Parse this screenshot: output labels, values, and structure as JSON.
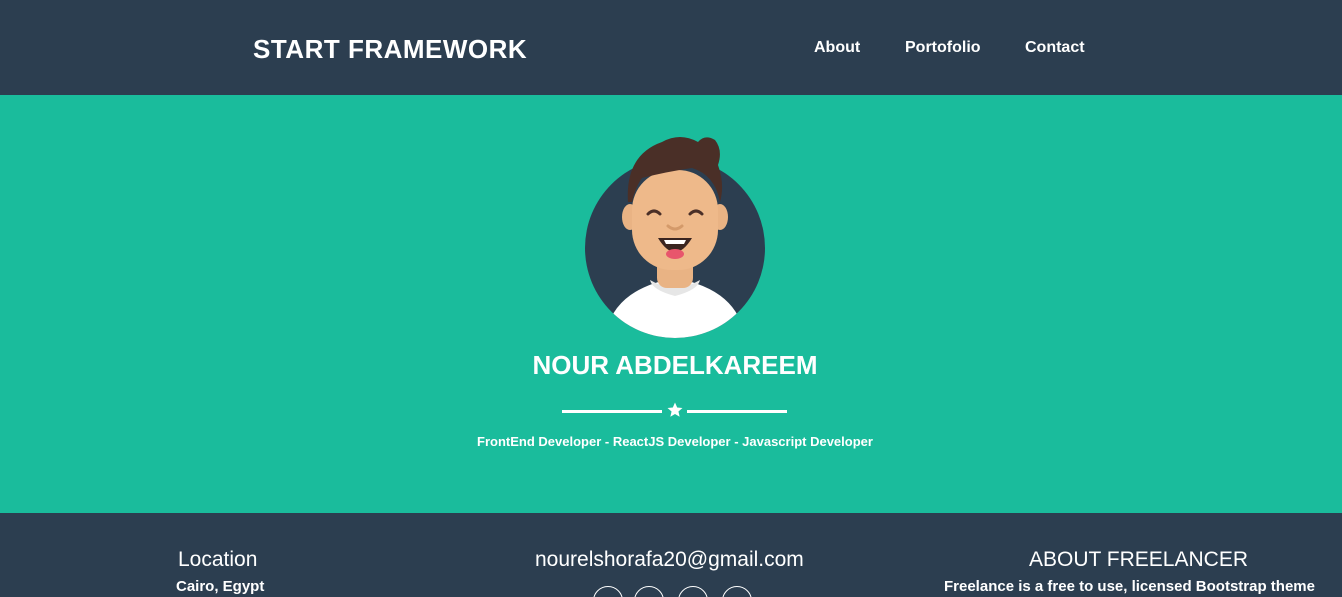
{
  "navbar": {
    "brand": "START FRAMEWORK",
    "links": [
      {
        "label": "About"
      },
      {
        "label": "Portofolio"
      },
      {
        "label": "Contact"
      }
    ]
  },
  "hero": {
    "name": "NOUR ABDELKAREEM",
    "subtitle": "FrontEnd Developer - ReactJS Developer - Javascript Developer",
    "divider_icon": "star-icon",
    "avatar_icon": "avatar-illustration"
  },
  "footer": {
    "location": {
      "heading": "Location",
      "text": "Cairo, Egypt"
    },
    "email": {
      "heading": "nourelshorafa20@gmail.com",
      "social_icons": [
        "social-icon-1",
        "social-icon-2",
        "social-icon-3",
        "social-icon-4"
      ]
    },
    "about": {
      "heading": "ABOUT FREELANCER",
      "text": "Freelance is a free to use, licensed Bootstrap theme"
    }
  },
  "colors": {
    "navbar_bg": "#2c3e50",
    "hero_bg": "#1abc9c",
    "text": "#ffffff"
  }
}
